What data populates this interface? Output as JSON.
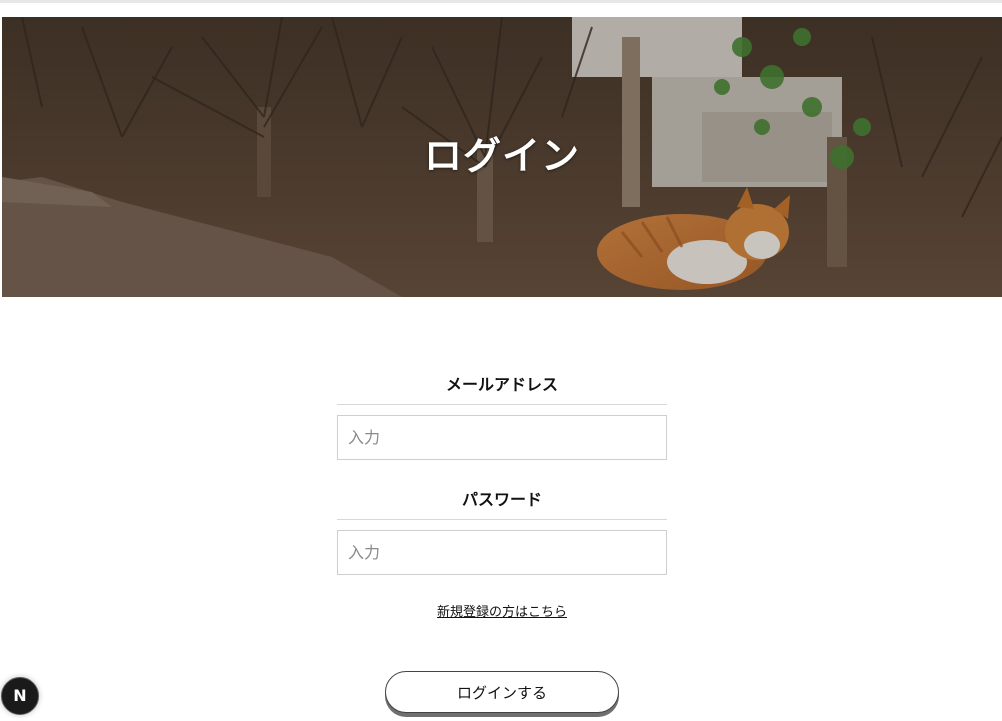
{
  "hero": {
    "title": "ログイン"
  },
  "form": {
    "email": {
      "label": "メールアドレス",
      "placeholder": "入力",
      "value": ""
    },
    "password": {
      "label": "パスワード",
      "placeholder": "入力",
      "value": ""
    },
    "register_link": "新規登録の方はこちら",
    "submit_label": "ログインする"
  },
  "dev_badge": {
    "icon": "nextjs-icon",
    "letter": "N"
  },
  "colors": {
    "background": "#ffffff",
    "text": "#111111",
    "input_border": "#cfcfcf",
    "button_shadow": "#6f6f6f",
    "hero_overlay": "#5a4636"
  }
}
